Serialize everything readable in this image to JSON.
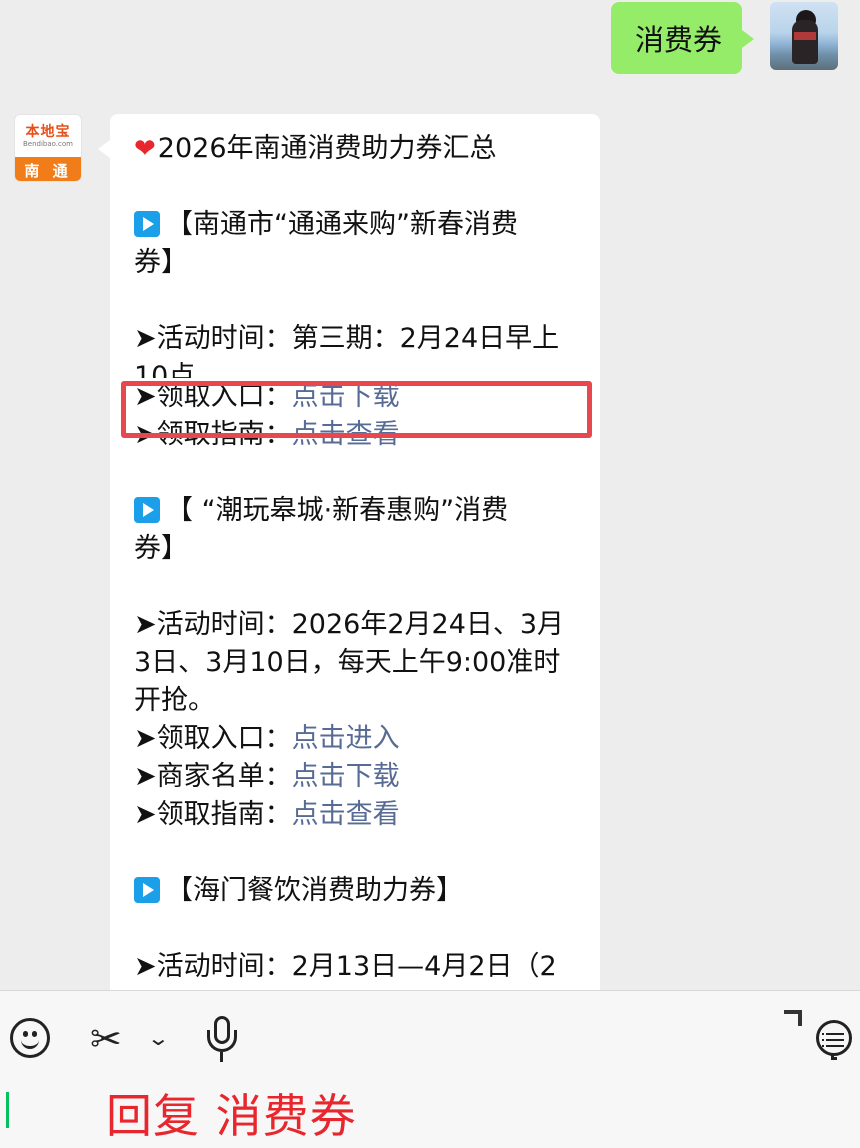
{
  "sent_message": {
    "text": "消费券"
  },
  "received_message": {
    "title": "2026年南通消费助力券汇总",
    "section1": {
      "heading_line1": "【南通市“通通来购”新春消费",
      "heading_line2": "券】",
      "time_line": "➤活动时间：第三期：2月24日早上",
      "time_cut": "10点",
      "entry_label": "➤领取入口：",
      "entry_link": "点击下载",
      "guide_label": "➤领取指南：",
      "guide_link": "点击查看"
    },
    "section2": {
      "heading_line1": "【 “潮玩皋城·新春惠购”消费",
      "heading_line2": "券】",
      "time_line1": "➤活动时间：2026年2月24日、3月",
      "time_line2": "3日、3月10日，每天上午9:00准时",
      "time_line3": "开抢。",
      "entry_label": "➤领取入口：",
      "entry_link": "点击进入",
      "merchant_label": "➤商家名单：",
      "merchant_link": "点击下载",
      "guide_label": "➤领取指南：",
      "guide_link": "点击查看"
    },
    "section3": {
      "heading": "【海门餐饮消费助力券】",
      "time_cut": "➤活动时间：2月13日—4月2日（2"
    }
  },
  "bot_avatar": {
    "brand": "本地宝",
    "domain": "Bendibao.com",
    "city": "南 通"
  },
  "input_bar": {
    "reply_text": "回复 消费券"
  },
  "colors": {
    "sent_bubble": "#95ec69",
    "link": "#576b95",
    "highlight": "#e8474d",
    "reply_text": "#e8262d"
  }
}
